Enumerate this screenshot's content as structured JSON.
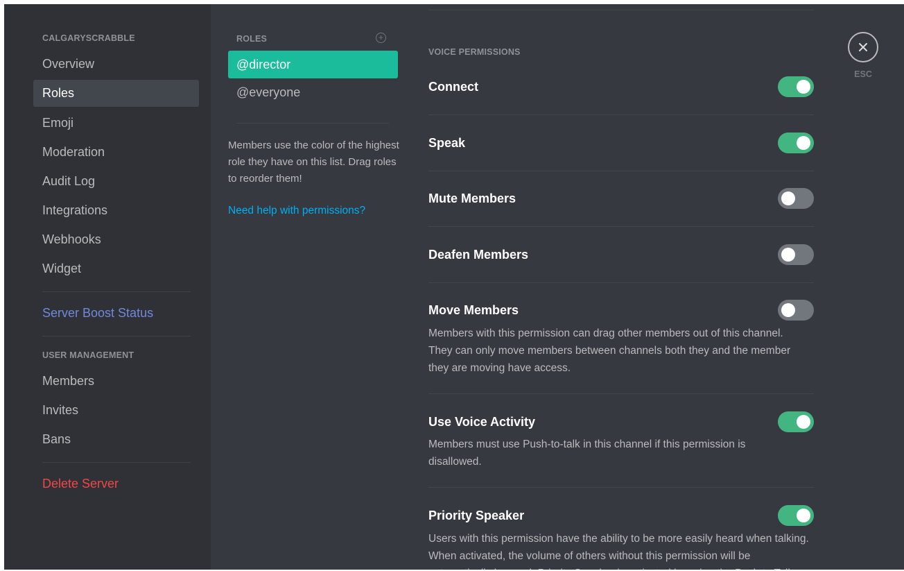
{
  "sidebar": {
    "server_heading": "CALGARYSCRABBLE",
    "items": [
      {
        "label": "Overview"
      },
      {
        "label": "Roles"
      },
      {
        "label": "Emoji"
      },
      {
        "label": "Moderation"
      },
      {
        "label": "Audit Log"
      },
      {
        "label": "Integrations"
      },
      {
        "label": "Webhooks"
      },
      {
        "label": "Widget"
      }
    ],
    "active_item": "Roles",
    "boost_label": "Server Boost Status",
    "user_mgmt_heading": "USER MANAGEMENT",
    "user_items": [
      {
        "label": "Members"
      },
      {
        "label": "Invites"
      },
      {
        "label": "Bans"
      }
    ],
    "delete_label": "Delete Server"
  },
  "roles": {
    "heading": "ROLES",
    "add_icon": "plus-circle-icon",
    "items": [
      {
        "label": "@director"
      },
      {
        "label": "@everyone"
      }
    ],
    "active_role": "@director",
    "description": "Members use the color of the highest role they have on this list. Drag roles to reorder them!",
    "help_link": "Need help with permissions?"
  },
  "permissions": {
    "section_heading": "VOICE PERMISSIONS",
    "items": [
      {
        "title": "Connect",
        "enabled": true,
        "description": ""
      },
      {
        "title": "Speak",
        "enabled": true,
        "description": ""
      },
      {
        "title": "Mute Members",
        "enabled": false,
        "description": ""
      },
      {
        "title": "Deafen Members",
        "enabled": false,
        "description": ""
      },
      {
        "title": "Move Members",
        "enabled": false,
        "description": "Members with this permission can drag other members out of this channel. They can only move members between channels both they and the member they are moving have access."
      },
      {
        "title": "Use Voice Activity",
        "enabled": true,
        "description": "Members must use Push-to-talk in this channel if this permission is disallowed."
      },
      {
        "title": "Priority Speaker",
        "enabled": true,
        "description": "Users with this permission have the ability to be more easily heard when talking. When activated, the volume of others without this permission will be automatically lowered. Priority Speaker is activated by using the Push to Talk"
      }
    ]
  },
  "close": {
    "icon": "close-icon",
    "esc_label": "ESC"
  },
  "colors": {
    "background": "#36393f",
    "sidebar": "#2f3136",
    "active_role": "#1abc9c",
    "toggle_on": "#43b581",
    "toggle_off": "#72767d",
    "link": "#00b0f4",
    "boost": "#7289da",
    "danger": "#f04747"
  }
}
